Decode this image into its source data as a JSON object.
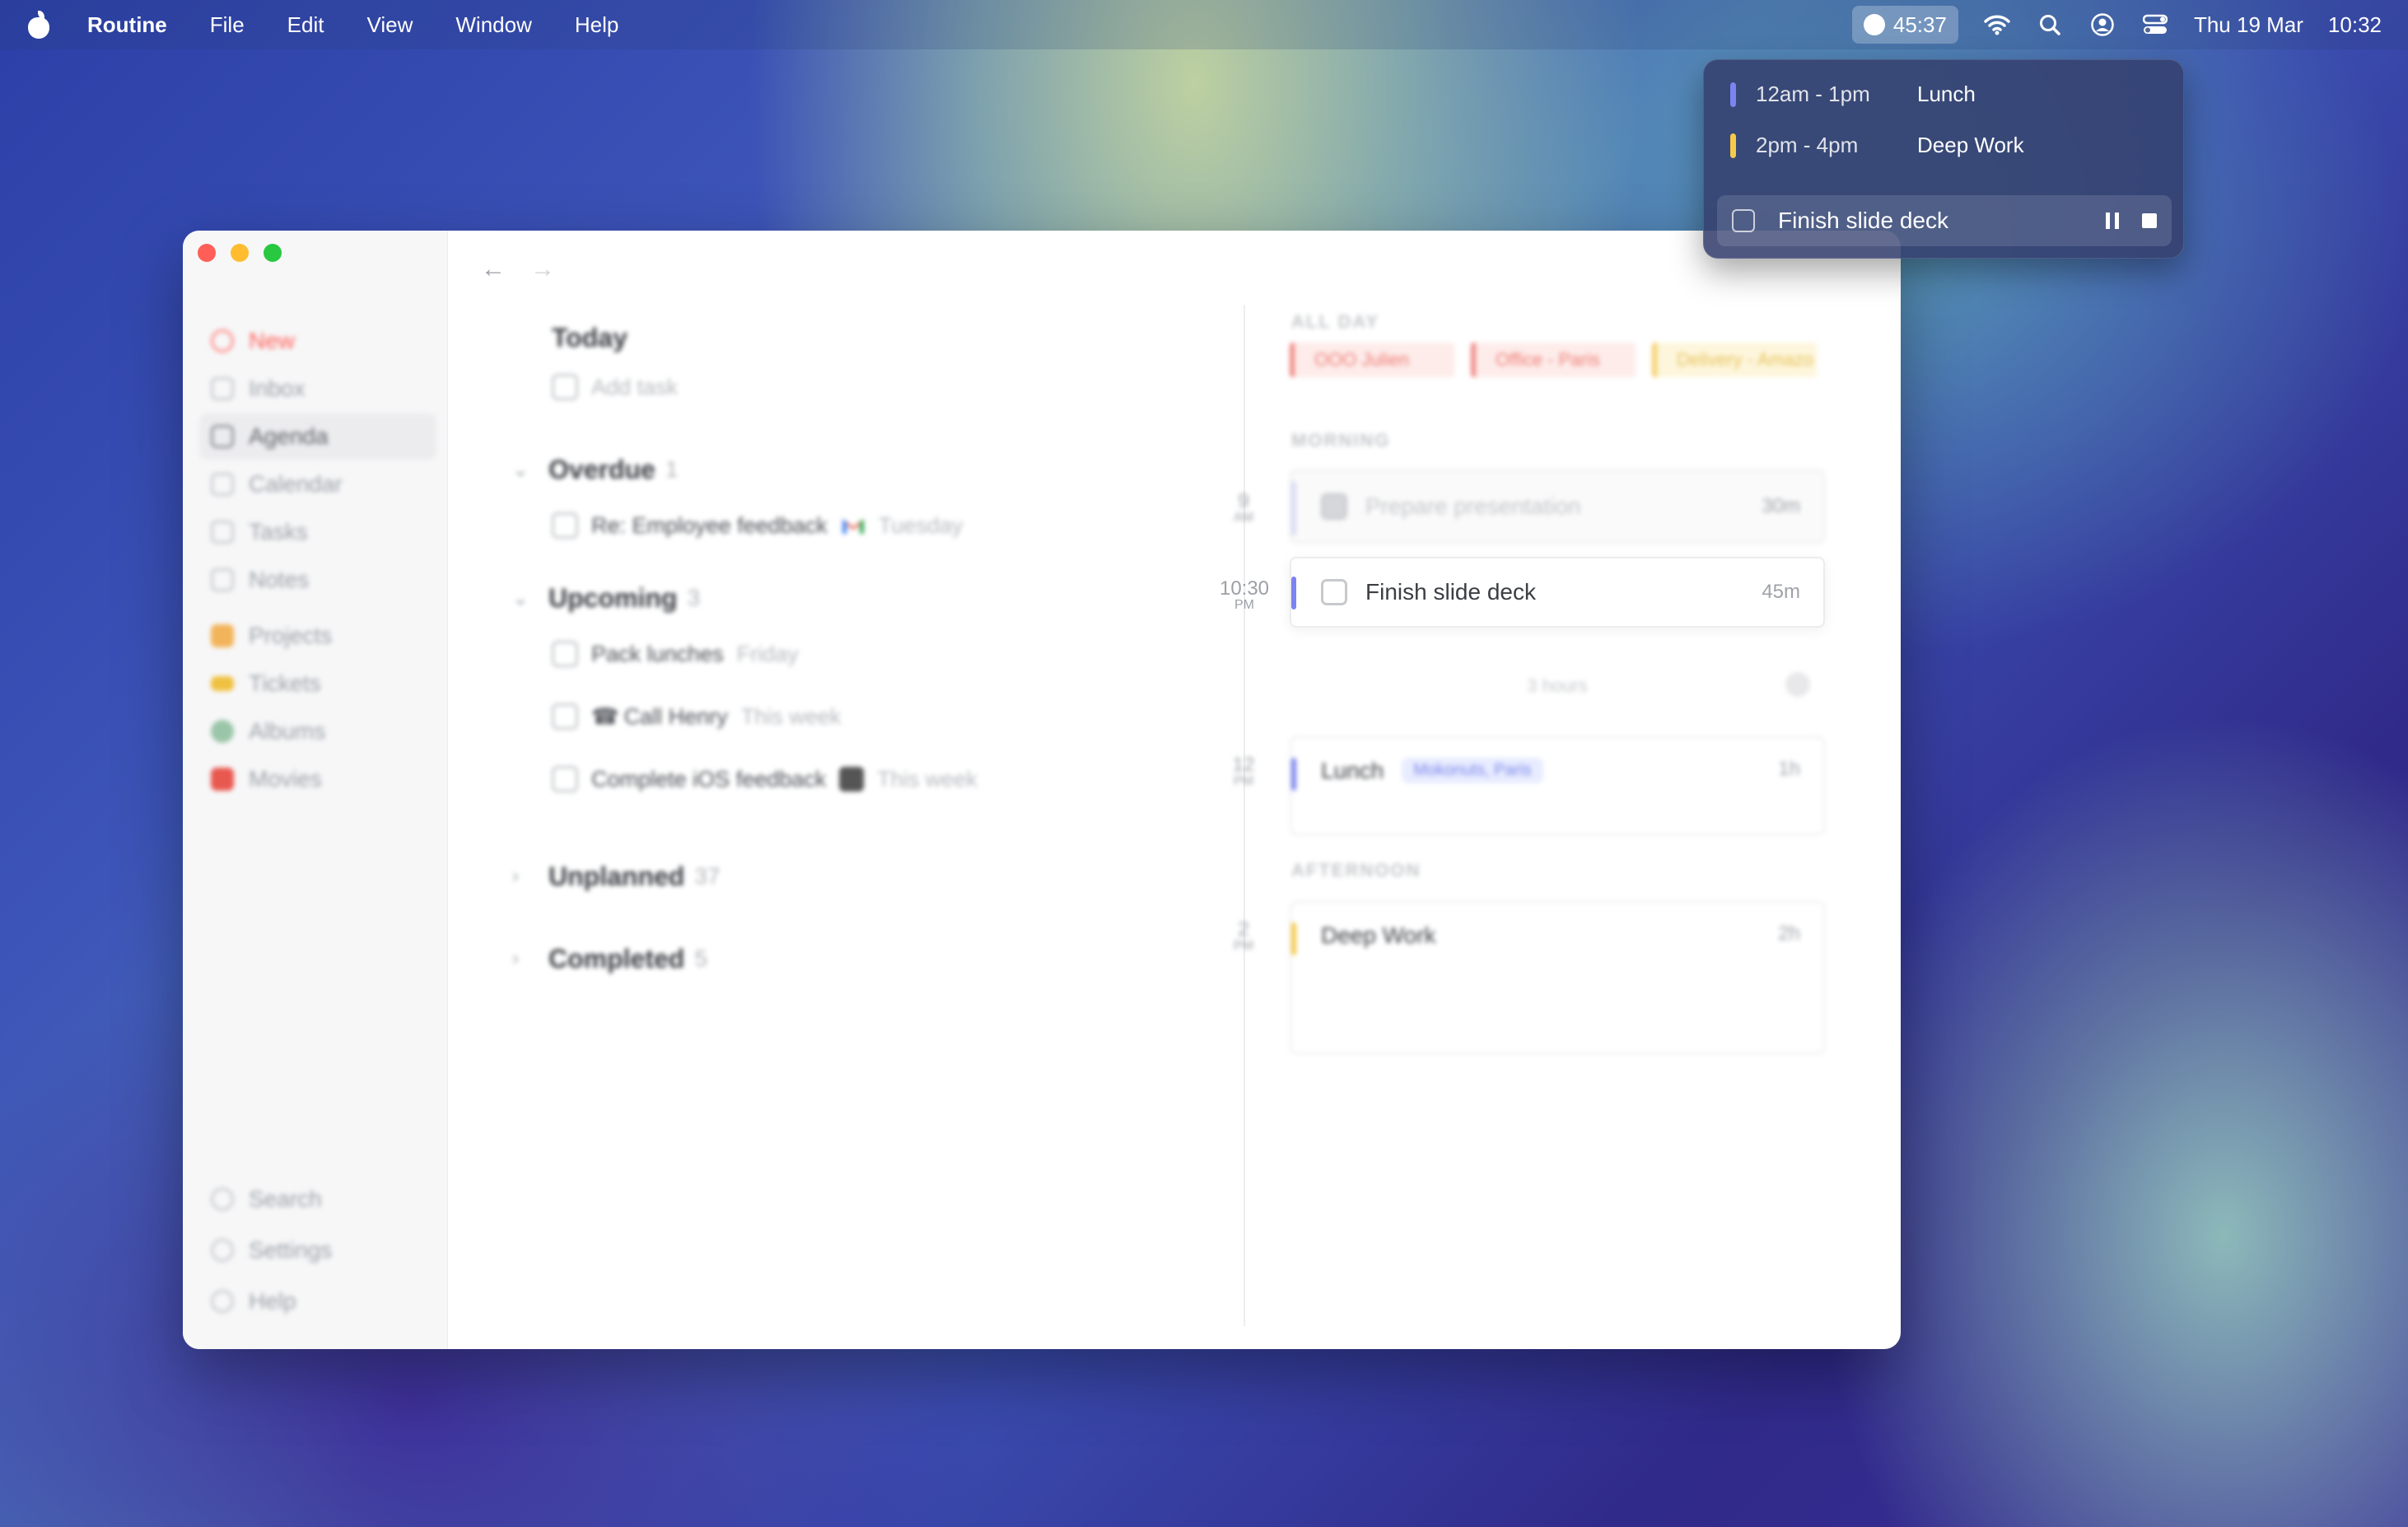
{
  "menubar": {
    "app_name": "Routine",
    "menus": [
      "File",
      "Edit",
      "View",
      "Window",
      "Help"
    ],
    "timer": "45:37",
    "date": "Thu 19 Mar",
    "time": "10:32"
  },
  "sidebar": {
    "items": [
      {
        "label": "New"
      },
      {
        "label": "Inbox"
      },
      {
        "label": "Agenda"
      },
      {
        "label": "Calendar"
      },
      {
        "label": "Tasks"
      },
      {
        "label": "Notes"
      },
      {
        "label": "Projects"
      },
      {
        "label": "Tickets"
      },
      {
        "label": "Albums"
      },
      {
        "label": "Movies"
      }
    ],
    "bottom": [
      {
        "label": "Search"
      },
      {
        "label": "Settings"
      },
      {
        "label": "Help"
      }
    ]
  },
  "agenda": {
    "today": {
      "title": "Today",
      "add_placeholder": "Add task"
    },
    "overdue": {
      "title": "Overdue",
      "count": "1",
      "tasks": [
        {
          "title": "Re: Employee feedback",
          "due": "Tuesday"
        }
      ]
    },
    "upcoming": {
      "title": "Upcoming",
      "count": "3",
      "tasks": [
        {
          "title": "Pack lunches",
          "due": "Friday"
        },
        {
          "title": "Call Henry",
          "due": "This week"
        },
        {
          "title": "Complete iOS feedback",
          "due": "This week"
        }
      ]
    },
    "unplanned": {
      "title": "Unplanned",
      "count": "37"
    },
    "completed": {
      "title": "Completed",
      "count": "5"
    }
  },
  "timeline": {
    "all_day_label": "ALL DAY",
    "all_day": [
      {
        "title": "OOO Julien",
        "color": "#f08a84"
      },
      {
        "title": "Office - Paris",
        "color": "#f08a84"
      },
      {
        "title": "Delivery - Amazo",
        "color": "#f5cf6a"
      }
    ],
    "morning_label": "MORNING",
    "afternoon_label": "AFTERNOON",
    "hours": [
      {
        "hour": "9",
        "suffix": "AM"
      },
      {
        "hour": "10:30",
        "suffix": "PM"
      },
      {
        "hour": "12",
        "suffix": "PM"
      },
      {
        "hour": "2",
        "suffix": "PM"
      }
    ],
    "events": [
      {
        "title": "Prepare presentation",
        "duration": "30m"
      },
      {
        "title": "Finish slide deck",
        "duration": "45m"
      },
      {
        "title": "Lunch",
        "duration": "1h",
        "location": "Mokonuts, Paris"
      },
      {
        "title": "Deep Work",
        "duration": "2h"
      }
    ],
    "gap_label": "3 hours"
  },
  "popover": {
    "events": [
      {
        "time": "12am - 1pm",
        "title": "Lunch",
        "color": "#7b84f0"
      },
      {
        "time": "2pm - 4pm",
        "title": "Deep Work",
        "color": "#f5c94a"
      }
    ],
    "current_task": "Finish slide deck"
  }
}
